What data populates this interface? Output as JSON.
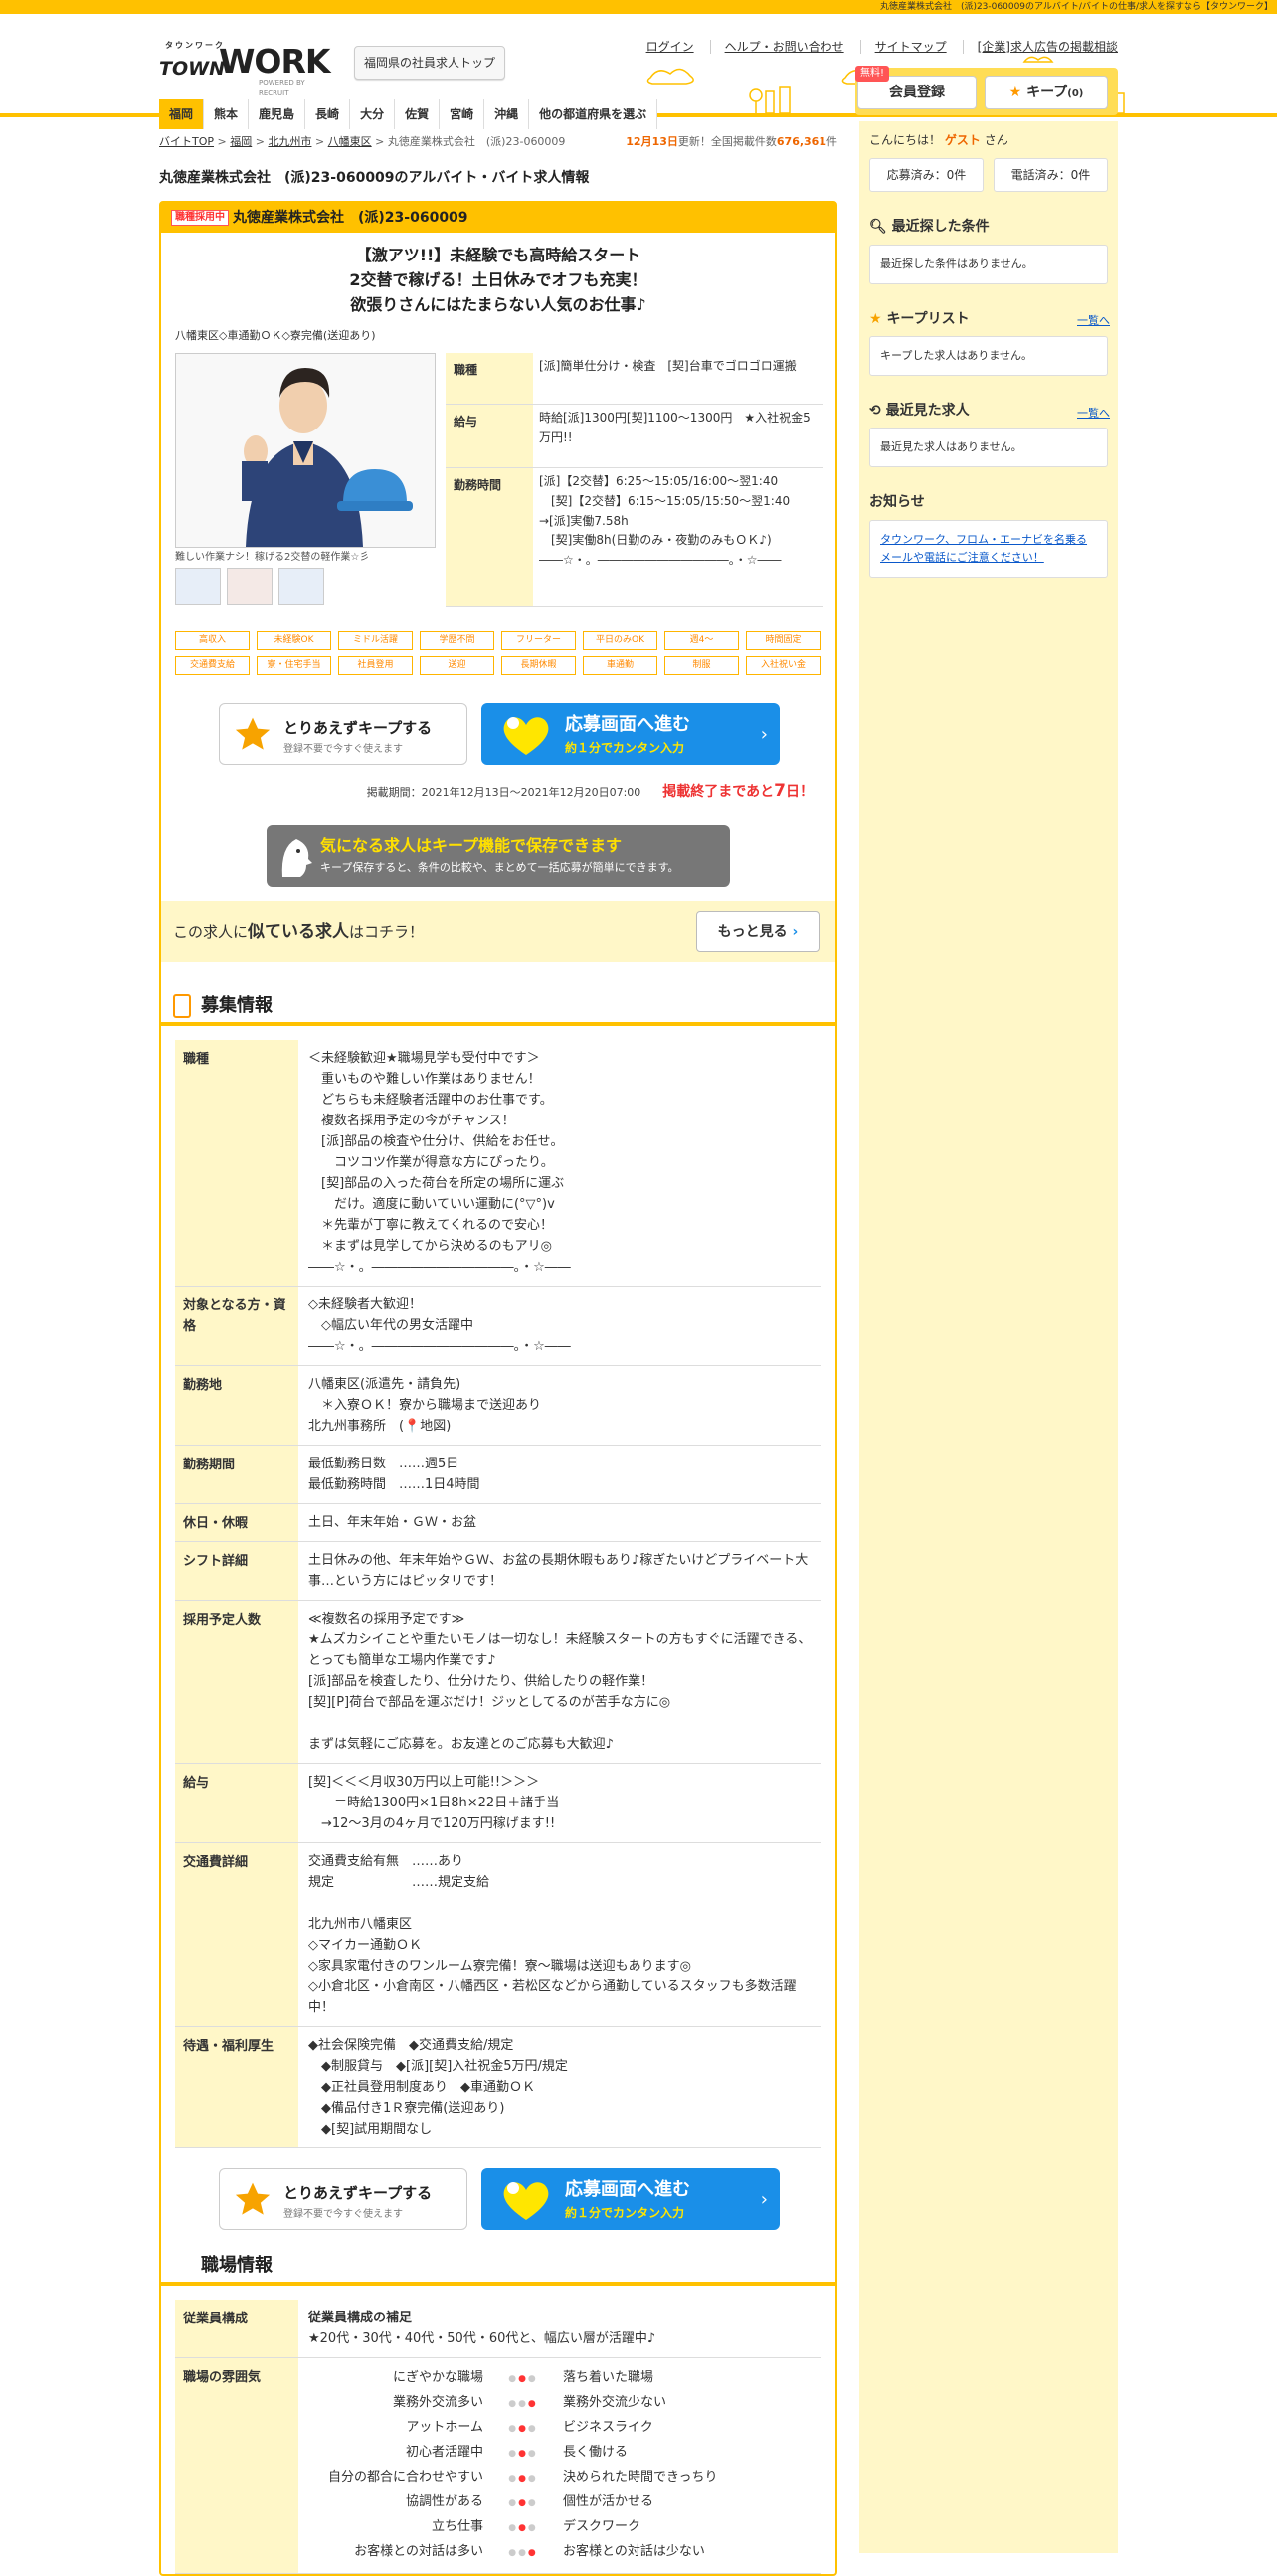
{
  "topbar": "丸徳産業株式会社　(派)23-060009のアルバイト/バイトの仕事/求人を探すなら【タウンワーク】",
  "logo": {
    "kana": "タウンワーク",
    "town": "TOWN",
    "work": "WORK",
    "powered": "POWERED BY RECRUIT"
  },
  "pref_button": "福岡県の社員求人トップ",
  "top_links": [
    "ログイン",
    "ヘルプ・お問い合わせ",
    "サイトマップ",
    "[企業]求人広告の掲載相談"
  ],
  "register": {
    "free": "無料!",
    "label": "会員登録"
  },
  "keep": {
    "label": "キープ",
    "count": "(0)"
  },
  "pref_nav": [
    "福岡",
    "熊本",
    "鹿児島",
    "長崎",
    "大分",
    "佐賀",
    "宮崎",
    "沖縄",
    "他の都道府県を選ぶ"
  ],
  "breadcrumb": [
    "バイトTOP",
    "福岡",
    "北九州市",
    "八幡東区",
    "丸徳産業株式会社　(派)23-060009"
  ],
  "update": {
    "date": "12月13日",
    "mid": "更新！全国掲載件数",
    "count": "676,361",
    "unit": "件"
  },
  "page_title": "丸徳産業株式会社　(派)23-060009のアルバイト・バイト求人情報",
  "job": {
    "badge": "職種採用中",
    "company": "丸徳産業株式会社　(派)23-060009",
    "catch": [
      "【激アツ!!】未経験でも高時給スタート",
      "2交替で稼げる！土日休みでオフも充実！",
      "欲張りさんにはたまらない人気のお仕事♪"
    ],
    "subline": "八幡東区◇車通勤ＯＫ◇寮完備(送迎あり)",
    "photo_caption": "難しい作業ナシ！稼げる2交替の軽作業☆彡",
    "details": [
      {
        "k": "職種",
        "v": "[派]簡単仕分け・検査　[契]台車でゴロゴロ運搬"
      },
      {
        "k": "給与",
        "v": "時給[派]1300円[契]1100～1300円　★入社祝金5万円!!"
      },
      {
        "k": "勤務時間",
        "v": "[派]【2交替】6:25～15:05/16:00～翌1:40\n　[契]【2交替】6:15～15:05/15:50～翌1:40\n→[派]実働7.58h\n　[契]実働8h(日勤のみ・夜勤のみもＯＫ♪)\n――☆・。―――――――――――。・☆――"
      }
    ],
    "tags": [
      "高収入",
      "未経験OK",
      "ミドル活躍",
      "学歴不問",
      "フリーター",
      "平日のみOK",
      "週4～",
      "時間固定",
      "交通費支給",
      "寮・住宅手当",
      "社員登用",
      "送迎",
      "長期休暇",
      "車通勤",
      "制服",
      "入社祝い金"
    ]
  },
  "cta": {
    "keep_title": "とりあえずキープする",
    "keep_sub": "登録不要で今すぐ使えます",
    "apply_title": "応募画面へ進む",
    "apply_sub": "約１分でカンタン入力"
  },
  "period": {
    "label": "掲載期間：2021年12月13日～2021年12月20日07:00",
    "end_pre": "掲載終了まであと",
    "days": "7",
    "end_post": "日！"
  },
  "keep_note": {
    "title": "気になる求人はキープ機能で保存できます",
    "sub": "キープ保存すると、条件の比較や、まとめて一括応募が簡単にできます。"
  },
  "similar": {
    "pre": "この求人に",
    "bold": "似ている求人",
    "post": "はコチラ！",
    "btn": "もっと見る"
  },
  "recruit": {
    "title": "募集情報",
    "rows": [
      {
        "k": "職種",
        "v": "＜未経験歓迎★職場見学も受付中です＞\n　重いものや難しい作業はありません！\n　どちらも未経験者活躍中のお仕事です。\n　複数名採用予定の今がチャンス！\n　[派]部品の検査や仕分け、供給をお任せ。\n　　コツコツ作業が得意な方にぴったり。\n　[契]部品の入った荷台を所定の場所に運ぶ\n　　だけ。適度に動いていい運動に(°▽°)v\n　＊先輩が丁寧に教えてくれるので安心！\n　＊まずは見学してから決めるのもアリ◎\n――☆・。―――――――――――。・☆――"
      },
      {
        "k": "対象となる方・資格",
        "v": "◇未経験者大歓迎！\n　◇幅広い年代の男女活躍中\n――☆・。―――――――――――。・☆――"
      },
      {
        "k": "勤務地",
        "v": "八幡東区(派遣先・請負先)\n　＊入寮ＯＫ！寮から職場まで送迎あり\n北九州事務所　(📍地図)"
      },
      {
        "k": "勤務期間",
        "v": "最低勤務日数　……週5日\n最低勤務時間　……1日4時間"
      },
      {
        "k": "休日・休暇",
        "v": "土日、年末年始・ＧＷ・お盆"
      },
      {
        "k": "シフト詳細",
        "v": "土日休みの他、年末年始やＧＷ、お盆の長期休暇もあり♪稼ぎたいけどプライベート大事…という方にはピッタリです！"
      },
      {
        "k": "採用予定人数",
        "v": "≪複数名の採用予定です≫\n★ムズカシイことや重たいモノは一切なし！未経験スタートの方もすぐに活躍できる、とっても簡単な工場内作業です♪\n[派]部品を検査したり、仕分けたり、供給したりの軽作業！\n[契][P]荷台で部品を運ぶだけ！ジッとしてるのが苦手な方に◎\n\nまずは気軽にご応募を。お友達とのご応募も大歓迎♪"
      },
      {
        "k": "給与",
        "v": "[契]＜＜＜月収30万円以上可能!!＞＞＞\n　　＝時給1300円×1日8h×22日＋諸手当\n　→12～3月の4ヶ月で120万円稼げます!!"
      },
      {
        "k": "交通費詳細",
        "v": "交通費支給有無　……あり\n規定　　　　　　……規定支給\n\n北九州市八幡東区\n◇マイカー通勤ＯＫ\n◇家具家電付きのワンルーム寮完備！寮～職場は送迎もあります◎\n◇小倉北区・小倉南区・八幡西区・若松区などから通勤しているスタッフも多数活躍中！"
      },
      {
        "k": "待遇・福利厚生",
        "v": "◆社会保険完備　◆交通費支給/規定\n　◆制服貸与　◆[派][契]入社祝金5万円/規定\n　◆正社員登用制度あり　◆車通勤ＯＫ\n　◆備品付き1Ｒ寮完備(送迎あり)\n　◆[契]試用期間なし"
      }
    ]
  },
  "workplace": {
    "title": "職場情報",
    "composition_label": "従業員構成",
    "composition_title": "従業員構成の補足",
    "composition_text": "★20代・30代・40代・50代・60代と、幅広い層が活躍中♪",
    "mood_label": "職場の雰囲気",
    "mood": [
      {
        "a": "にぎやかな職場",
        "pos": 2,
        "b": "落ち着いた職場"
      },
      {
        "a": "業務外交流多い",
        "pos": 3,
        "b": "業務外交流少ない"
      },
      {
        "a": "アットホーム",
        "pos": 2,
        "b": "ビジネスライク"
      },
      {
        "a": "初心者活躍中",
        "pos": 2,
        "b": "長く働ける"
      },
      {
        "a": "自分の都合に合わせやすい",
        "pos": 2,
        "b": "決められた時間できっちり"
      },
      {
        "a": "協調性がある",
        "pos": 2,
        "b": "個性が活かせる"
      },
      {
        "a": "立ち仕事",
        "pos": 2,
        "b": "デスクワーク"
      },
      {
        "a": "お客様との対話は多い",
        "pos": 3,
        "b": "お客様との対話は少ない"
      }
    ]
  },
  "side": {
    "hello_pre": "こんにちは！",
    "guest": "ゲスト",
    "hello_post": "さん",
    "applied": "応募済み：0件",
    "called": "電話済み：0件",
    "recent_title": "最近探した条件",
    "recent_text": "最近探した条件はありません。",
    "keep_title": "キープリスト",
    "more": "一覧へ",
    "keep_text": "キープした求人はありません。",
    "viewed_title": "最近見た求人",
    "viewed_text": "最近見た求人はありません。",
    "notice_title": "お知らせ",
    "notice_text": "タウンワーク、フロム・エーナビを名乗るメールや電話にご注意ください！"
  }
}
